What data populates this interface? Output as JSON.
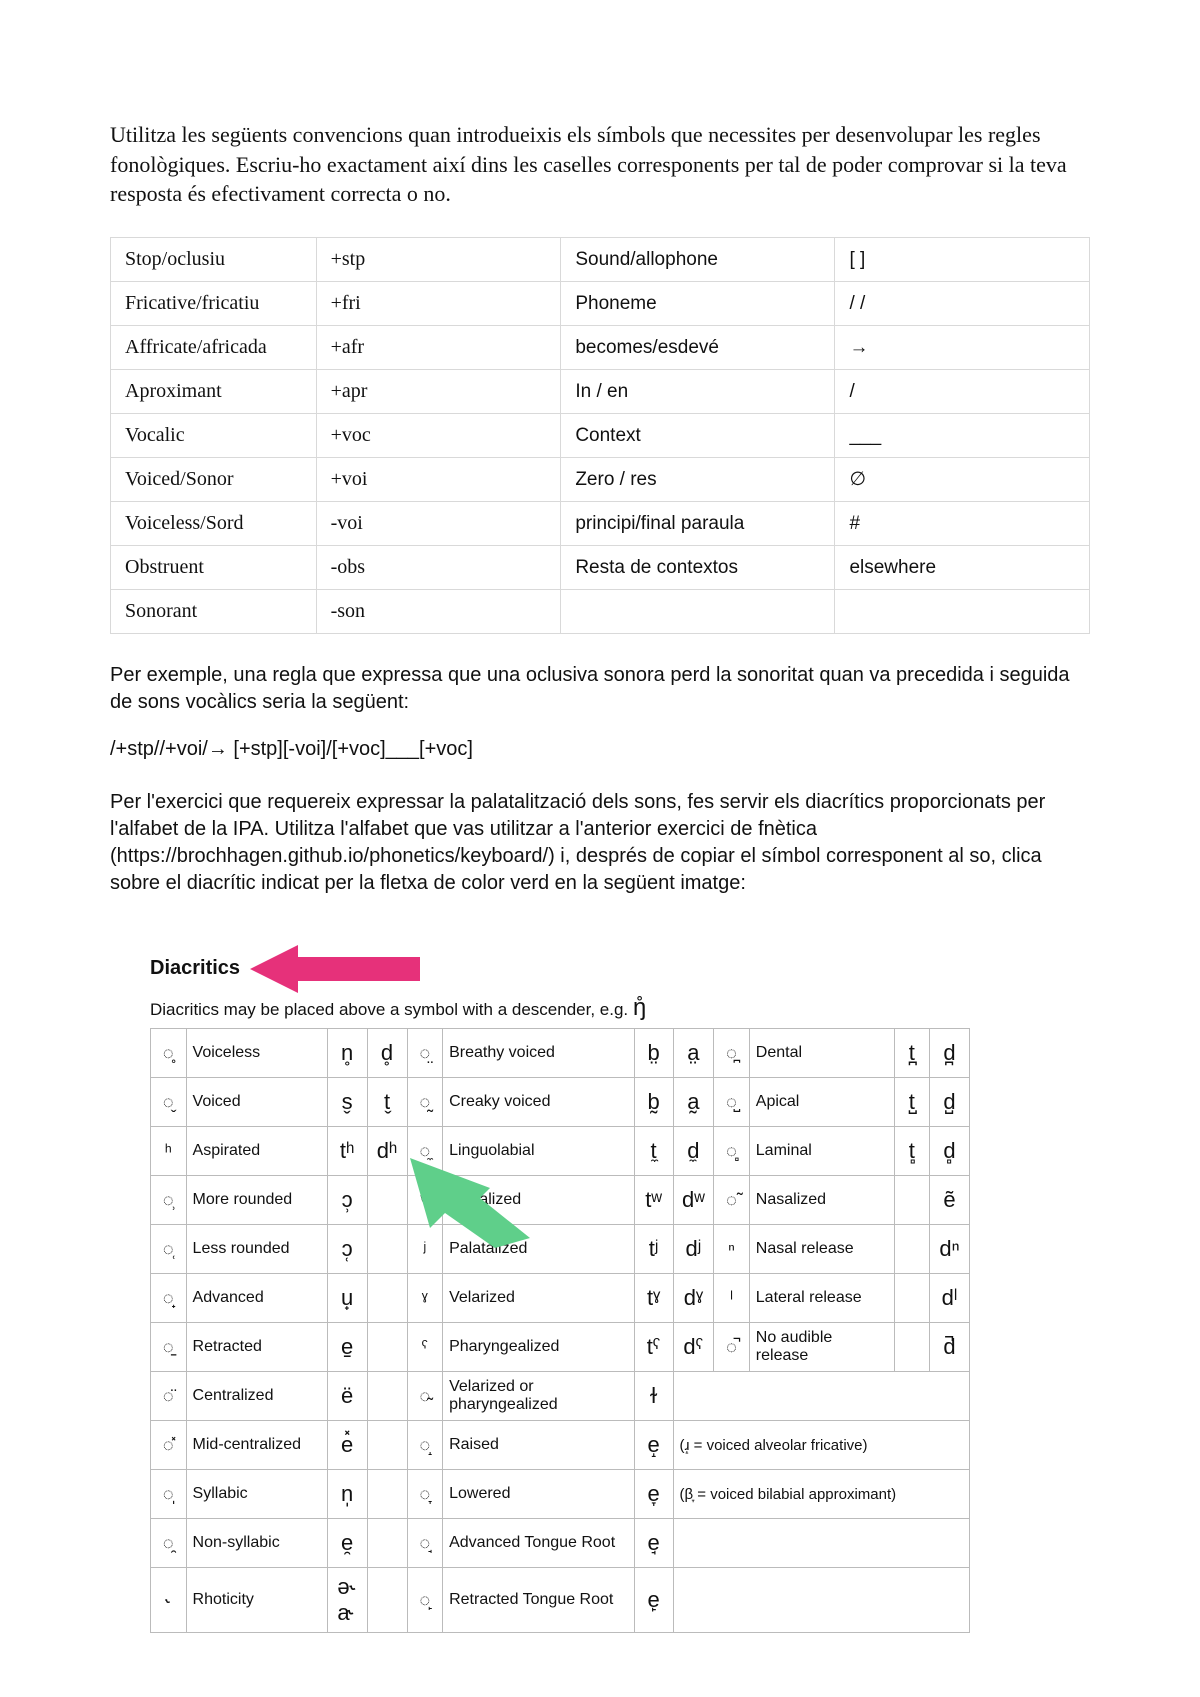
{
  "intro": "Utilitza les següents convencions quan introdueixis els símbols que necessites per desenvolupar les regles fonològiques. Escriu-ho exactament així dins les caselles corresponents per tal de poder comprovar si la teva resposta és efectivament correcta o no.",
  "conv": {
    "rows": [
      {
        "c1": "Stop/oclusiu",
        "c2": "+stp",
        "c3": "Sound/allophone",
        "c4": "[ ]"
      },
      {
        "c1": "Fricative/fricatiu",
        "c2": "+fri",
        "c3": "Phoneme",
        "c4": "/ /"
      },
      {
        "c1": "Affricate/africada",
        "c2": "+afr",
        "c3": "becomes/esdevé",
        "c4": "→"
      },
      {
        "c1": "Aproximant",
        "c2": "+apr",
        "c3": "In / en",
        "c4": "/"
      },
      {
        "c1": "Vocalic",
        "c2": "+voc",
        "c3": "Context",
        "c4": "___"
      },
      {
        "c1": "Voiced/Sonor",
        "c2": "+voi",
        "c3": "Zero / res",
        "c4": "∅"
      },
      {
        "c1": "Voiceless/Sord",
        "c2": "-voi",
        "c3": "principi/final paraula",
        "c4": "#"
      },
      {
        "c1": "Obstruent",
        "c2": "-obs",
        "c3": "Resta de contextos",
        "c4": "elsewhere"
      },
      {
        "c1": "Sonorant",
        "c2": "-son",
        "c3": "",
        "c4": ""
      }
    ]
  },
  "example_para": "Per exemple, una regla que expressa que una oclusiva sonora perd la sonoritat quan va precedida i seguida de sons vocàlics seria la següent:",
  "rule_example": "/+stp//+voi/→ [+stp][-voi]/[+voc]___[+voc]",
  "exercise_para": "Per l'exercici que requereix expressar la palatalització dels sons, fes servir els diacrítics proporcionats per l'alfabet de la IPA. Utilitza l'alfabet que vas utilitzar a l'anterior exercici de fnètica (https://brochhagen.github.io/phonetics/keyboard/) i, després de copiar el símbol corresponent al so, clica sobre el diacrític indicat per la fletxa de color verd en la següent imatge:",
  "dia": {
    "title": "Diacritics",
    "subtitle_pre": "Diacritics may be placed above a symbol with a descender, e.g. ",
    "subtitle_sym": "ŋ̊",
    "rows": [
      {
        "m1": "◌̥",
        "l1": "Voiceless",
        "e1a": "n̥",
        "e1b": "d̥",
        "m2": "◌̤",
        "l2": "Breathy voiced",
        "e2a": "b̤",
        "e2b": "a̤",
        "m3": "◌̪",
        "l3": "Dental",
        "e3a": "t̪",
        "e3b": "d̪"
      },
      {
        "m1": "◌̬",
        "l1": "Voiced",
        "e1a": "s̬",
        "e1b": "t̬",
        "m2": "◌̰",
        "l2": "Creaky voiced",
        "e2a": "b̰",
        "e2b": "a̰",
        "m3": "◌̺",
        "l3": "Apical",
        "e3a": "t̺",
        "e3b": "d̺"
      },
      {
        "m1": "ʰ",
        "l1": "Aspirated",
        "e1a": "tʰ",
        "e1b": "dʰ",
        "m2": "◌̼",
        "l2": "Linguolabial",
        "e2a": "t̼",
        "e2b": "d̼",
        "m3": "◌̻",
        "l3": "Laminal",
        "e3a": "t̻",
        "e3b": "d̻"
      },
      {
        "m1": "◌̹",
        "l1": "More rounded",
        "e1a": "ɔ̹",
        "e1b": "",
        "m2": "ʷ",
        "l2": "Labialized",
        "e2a": "tʷ",
        "e2b": "dʷ",
        "m3": "◌̃",
        "l3": "Nasalized",
        "e3a": "",
        "e3b": "ẽ"
      },
      {
        "m1": "◌̜",
        "l1": "Less rounded",
        "e1a": "ɔ̜",
        "e1b": "",
        "m2": "ʲ",
        "l2": "Palatalized",
        "e2a": "tʲ",
        "e2b": "dʲ",
        "m3": "ⁿ",
        "l3": "Nasal release",
        "e3a": "",
        "e3b": "dⁿ"
      },
      {
        "m1": "◌̟",
        "l1": "Advanced",
        "e1a": "u̟",
        "e1b": "",
        "m2": "ˠ",
        "l2": "Velarized",
        "e2a": "tˠ",
        "e2b": "dˠ",
        "m3": "ˡ",
        "l3": "Lateral release",
        "e3a": "",
        "e3b": "dˡ"
      },
      {
        "m1": "◌̠",
        "l1": "Retracted",
        "e1a": "e̠",
        "e1b": "",
        "m2": "ˤ",
        "l2": "Pharyngealized",
        "e2a": "tˤ",
        "e2b": "dˤ",
        "m3": "◌̚",
        "l3": "No audible release",
        "e3a": "",
        "e3b": "d̚"
      },
      {
        "m1": "◌̈",
        "l1": "Centralized",
        "e1a": "ë",
        "e1b": "",
        "m2": "◌̴",
        "l2": "Velarized or pharyngealized",
        "e2a": "ɫ",
        "e2b": "",
        "merge23": true
      },
      {
        "m1": "◌̽",
        "l1": "Mid-centralized",
        "e1a": "e̽",
        "e1b": "",
        "m2": "◌̝",
        "l2": "Raised",
        "e2a": "e̝",
        "e2b": "",
        "note": "(ɹ̝ = voiced alveolar fricative)"
      },
      {
        "m1": "◌̩",
        "l1": "Syllabic",
        "e1a": "n̩",
        "e1b": "",
        "m2": "◌̞",
        "l2": "Lowered",
        "e2a": "e̞",
        "e2b": "",
        "note": "(β̞ = voiced bilabial approximant)"
      },
      {
        "m1": "◌̯",
        "l1": "Non-syllabic",
        "e1a": "e̯",
        "e1b": "",
        "m2": "◌̘",
        "l2": "Advanced Tongue Root",
        "e2a": "e̘",
        "e2b": "",
        "merge23": true
      },
      {
        "m1": "˞",
        "l1": "Rhoticity",
        "e1a": "ə˞ a˞",
        "e1b": "",
        "m2": "◌̙",
        "l2": "Retracted Tongue Root",
        "e2a": "e̙",
        "e2b": "",
        "merge23": true
      }
    ]
  }
}
